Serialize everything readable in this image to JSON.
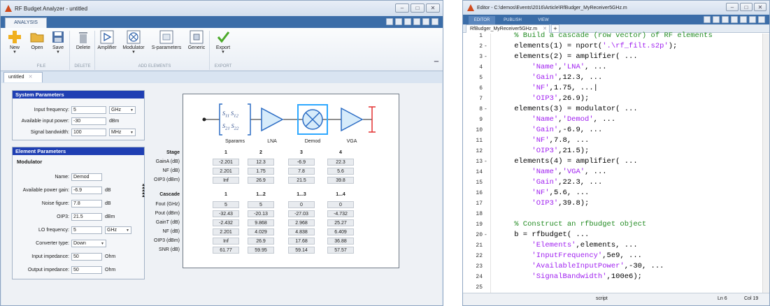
{
  "left": {
    "title": "RF Budget Analyzer - untitled",
    "ribbon_tab": "ANALYSIS",
    "buttons": [
      {
        "label": "New",
        "icon": "plus-icon"
      },
      {
        "label": "Open",
        "icon": "folder-icon"
      },
      {
        "label": "Save",
        "icon": "disk-icon"
      },
      {
        "label": "Delete",
        "icon": "trash-icon"
      },
      {
        "label": "Amplifier",
        "icon": "amplifier-icon"
      },
      {
        "label": "Modulator",
        "icon": "modulator-icon"
      },
      {
        "label": "S-parameters",
        "icon": "sparameters-icon"
      },
      {
        "label": "Generic",
        "icon": "generic-icon"
      },
      {
        "label": "Export",
        "icon": "checkmark-icon"
      }
    ],
    "groups": {
      "file": "FILE",
      "delete": "DELETE",
      "add": "ADD ELEMENTS",
      "export": "EXPORT"
    },
    "doc_tab": "untitled",
    "system": {
      "header": "System Parameters",
      "input_frequency_label": "Input frequency:",
      "input_frequency_value": "5",
      "input_frequency_unit": "GHz",
      "available_power_label": "Available input power:",
      "available_power_value": "-30",
      "available_power_unit": "dBm",
      "bandwidth_label": "Signal bandwidth:",
      "bandwidth_value": "100",
      "bandwidth_unit": "MHz"
    },
    "element": {
      "header": "Element Parameters",
      "section": "Modulator",
      "name_label": "Name:",
      "name_value": "Demod",
      "gain_label": "Available power gain:",
      "gain_value": "-6.9",
      "gain_unit": "dB",
      "nf_label": "Noise figure:",
      "nf_value": "7.8",
      "nf_unit": "dB",
      "oip3_label": "OIP3:",
      "oip3_value": "21.5",
      "oip3_unit": "dBm",
      "lo_label": "LO frequency:",
      "lo_value": "5",
      "lo_unit": "GHz",
      "conv_label": "Converter type:",
      "conv_value": "Down",
      "zin_label": "Input impedance:",
      "zin_value": "50",
      "zin_unit": "Ohm",
      "zout_label": "Output impedance:",
      "zout_value": "50",
      "zout_unit": "Ohm"
    },
    "diagram": {
      "sparam_lines": [
        "S",
        "11",
        "S",
        "12",
        "S",
        "21",
        "S",
        "22"
      ],
      "labels": [
        "Sparams",
        "LNA",
        "Demod",
        "VGA"
      ]
    },
    "stage": {
      "header": "Stage",
      "cols": [
        "1",
        "2",
        "3",
        "4"
      ],
      "rows": [
        {
          "label": "GainA (dB)",
          "values": [
            "-2.201",
            "12.3",
            "-6.9",
            "22.3"
          ]
        },
        {
          "label": "NF (dB)",
          "values": [
            "2.201",
            "1.75",
            "7.8",
            "5.6"
          ]
        },
        {
          "label": "OIP3 (dBm)",
          "values": [
            "Inf",
            "26.9",
            "21.5",
            "39.8"
          ]
        }
      ]
    },
    "cascade": {
      "header": "Cascade",
      "cols": [
        "1",
        "1...2",
        "1...3",
        "1...4"
      ],
      "rows": [
        {
          "label": "Fout (GHz)",
          "values": [
            "5",
            "5",
            "0",
            "0"
          ]
        },
        {
          "label": "Pout (dBm)",
          "values": [
            "-32.43",
            "-20.13",
            "-27.03",
            "-4.732"
          ]
        },
        {
          "label": "GainT (dB)",
          "values": [
            "-2.432",
            "9.868",
            "2.968",
            "25.27"
          ]
        },
        {
          "label": "NF (dB)",
          "values": [
            "2.201",
            "4.029",
            "4.838",
            "6.409"
          ]
        },
        {
          "label": "OIP3 (dBm)",
          "values": [
            "Inf",
            "26.9",
            "17.68",
            "36.88"
          ]
        },
        {
          "label": "SNR (dB)",
          "values": [
            "61.77",
            "59.95",
            "59.14",
            "57.57"
          ]
        }
      ]
    }
  },
  "right": {
    "title": "Editor - C:\\demos\\Events\\2016\\Article\\RfBudger_MyReceiver5GHz.m",
    "tabs": [
      "EDITOR",
      "PUBLISH",
      "VIEW"
    ],
    "file_tab": "RfBudger_MyReceiver5GHz.m",
    "lines": [
      {
        "n": "1",
        "d": "",
        "parts": [
          {
            "t": "    % Build a cascade (row vector) of RF elements",
            "k": "c"
          }
        ]
      },
      {
        "n": "2",
        "d": "-",
        "parts": [
          {
            "t": "    elements(1) = nport(",
            "k": ""
          },
          {
            "t": "'.\\rf_filt.s2p'",
            "k": "s"
          },
          {
            "t": ");",
            "k": ""
          }
        ]
      },
      {
        "n": "3",
        "d": "-",
        "parts": [
          {
            "t": "    elements(2) = amplifier( ...",
            "k": ""
          }
        ]
      },
      {
        "n": "4",
        "d": "",
        "parts": [
          {
            "t": "        ",
            "k": ""
          },
          {
            "t": "'Name'",
            "k": "s"
          },
          {
            "t": ",",
            "k": ""
          },
          {
            "t": "'LNA'",
            "k": "s"
          },
          {
            "t": ", ...",
            "k": ""
          }
        ]
      },
      {
        "n": "5",
        "d": "",
        "parts": [
          {
            "t": "        ",
            "k": ""
          },
          {
            "t": "'Gain'",
            "k": "s"
          },
          {
            "t": ",12.3, ...",
            "k": ""
          }
        ]
      },
      {
        "n": "6",
        "d": "",
        "parts": [
          {
            "t": "        ",
            "k": ""
          },
          {
            "t": "'NF'",
            "k": "s"
          },
          {
            "t": ",1.75, ...|",
            "k": ""
          }
        ]
      },
      {
        "n": "7",
        "d": "",
        "parts": [
          {
            "t": "        ",
            "k": ""
          },
          {
            "t": "'OIP3'",
            "k": "s"
          },
          {
            "t": ",26.9);",
            "k": ""
          }
        ]
      },
      {
        "n": "8",
        "d": "-",
        "parts": [
          {
            "t": "    elements(3) = modulator( ...",
            "k": ""
          }
        ]
      },
      {
        "n": "9",
        "d": "",
        "parts": [
          {
            "t": "        ",
            "k": ""
          },
          {
            "t": "'Name'",
            "k": "s"
          },
          {
            "t": ",",
            "k": ""
          },
          {
            "t": "'Demod'",
            "k": "s"
          },
          {
            "t": ", ...",
            "k": ""
          }
        ]
      },
      {
        "n": "10",
        "d": "",
        "parts": [
          {
            "t": "        ",
            "k": ""
          },
          {
            "t": "'Gain'",
            "k": "s"
          },
          {
            "t": ",-6.9, ...",
            "k": ""
          }
        ]
      },
      {
        "n": "11",
        "d": "",
        "parts": [
          {
            "t": "        ",
            "k": ""
          },
          {
            "t": "'NF'",
            "k": "s"
          },
          {
            "t": ",7.8, ...",
            "k": ""
          }
        ]
      },
      {
        "n": "12",
        "d": "",
        "parts": [
          {
            "t": "        ",
            "k": ""
          },
          {
            "t": "'OIP3'",
            "k": "s"
          },
          {
            "t": ",21.5);",
            "k": ""
          }
        ]
      },
      {
        "n": "13",
        "d": "-",
        "parts": [
          {
            "t": "    elements(4) = amplifier( ...",
            "k": ""
          }
        ]
      },
      {
        "n": "14",
        "d": "",
        "parts": [
          {
            "t": "        ",
            "k": ""
          },
          {
            "t": "'Name'",
            "k": "s"
          },
          {
            "t": ",",
            "k": ""
          },
          {
            "t": "'VGA'",
            "k": "s"
          },
          {
            "t": ", ...",
            "k": ""
          }
        ]
      },
      {
        "n": "15",
        "d": "",
        "parts": [
          {
            "t": "        ",
            "k": ""
          },
          {
            "t": "'Gain'",
            "k": "s"
          },
          {
            "t": ",22.3, ...",
            "k": ""
          }
        ]
      },
      {
        "n": "16",
        "d": "",
        "parts": [
          {
            "t": "        ",
            "k": ""
          },
          {
            "t": "'NF'",
            "k": "s"
          },
          {
            "t": ",5.6, ...",
            "k": ""
          }
        ]
      },
      {
        "n": "17",
        "d": "",
        "parts": [
          {
            "t": "        ",
            "k": ""
          },
          {
            "t": "'OIP3'",
            "k": "s"
          },
          {
            "t": ",39.8);",
            "k": ""
          }
        ]
      },
      {
        "n": "18",
        "d": "",
        "parts": [
          {
            "t": "",
            "k": ""
          }
        ]
      },
      {
        "n": "19",
        "d": "",
        "parts": [
          {
            "t": "    % Construct an rfbudget object",
            "k": "c"
          }
        ]
      },
      {
        "n": "20",
        "d": "-",
        "parts": [
          {
            "t": "    b = rfbudget( ...",
            "k": ""
          }
        ]
      },
      {
        "n": "21",
        "d": "",
        "parts": [
          {
            "t": "        ",
            "k": ""
          },
          {
            "t": "'Elements'",
            "k": "s"
          },
          {
            "t": ",elements, ...",
            "k": ""
          }
        ]
      },
      {
        "n": "22",
        "d": "",
        "parts": [
          {
            "t": "        ",
            "k": ""
          },
          {
            "t": "'InputFrequency'",
            "k": "s"
          },
          {
            "t": ",5e9, ...",
            "k": ""
          }
        ]
      },
      {
        "n": "23",
        "d": "",
        "parts": [
          {
            "t": "        ",
            "k": ""
          },
          {
            "t": "'AvailableInputPower'",
            "k": "s"
          },
          {
            "t": ",-30, ...",
            "k": ""
          }
        ]
      },
      {
        "n": "24",
        "d": "",
        "parts": [
          {
            "t": "        ",
            "k": ""
          },
          {
            "t": "'SignalBandwidth'",
            "k": "s"
          },
          {
            "t": ",100e6);",
            "k": ""
          }
        ]
      },
      {
        "n": "25",
        "d": "",
        "parts": [
          {
            "t": "",
            "k": ""
          }
        ]
      }
    ],
    "status": {
      "mode": "script",
      "ln": "Ln 6",
      "col": "Col 19"
    }
  }
}
